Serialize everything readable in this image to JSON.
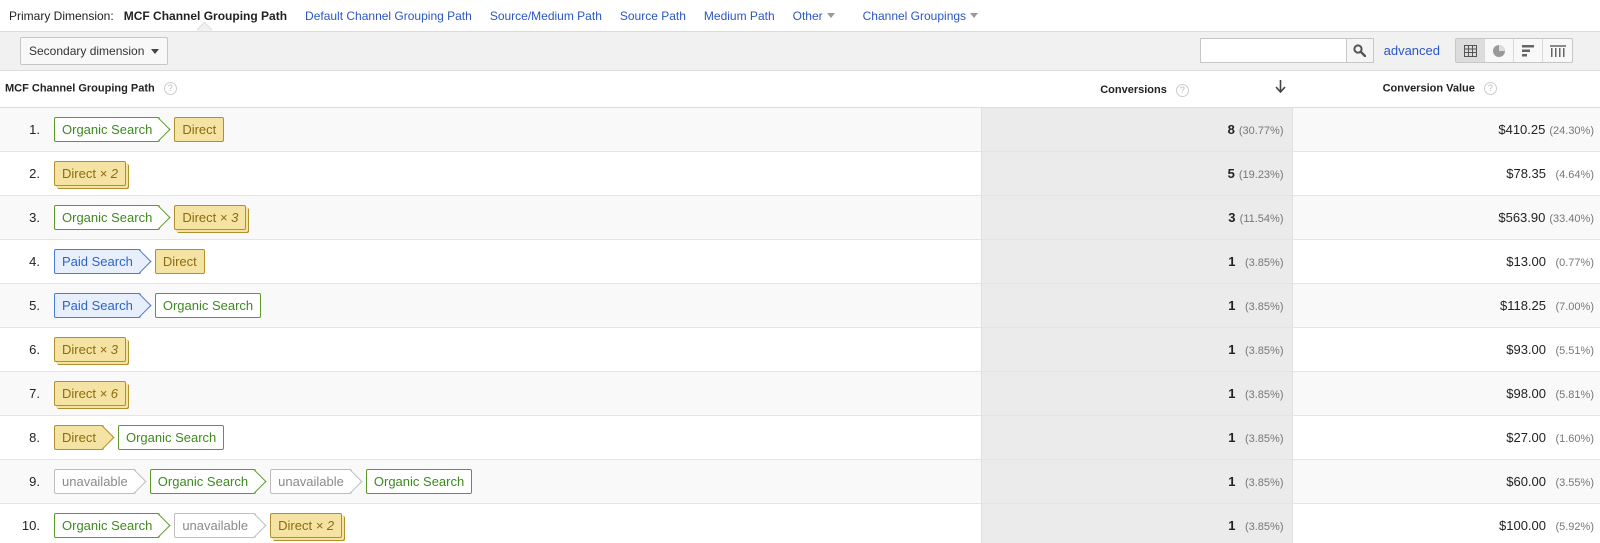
{
  "primary_dimension": {
    "label": "Primary Dimension:",
    "options": [
      {
        "label": "MCF Channel Grouping Path",
        "active": true
      },
      {
        "label": "Default Channel Grouping Path",
        "active": false
      },
      {
        "label": "Source/Medium Path",
        "active": false
      },
      {
        "label": "Source Path",
        "active": false
      },
      {
        "label": "Medium Path",
        "active": false
      }
    ],
    "other_label": "Other",
    "channel_groupings_label": "Channel Groupings"
  },
  "toolbar": {
    "secondary_dimension_label": "Secondary dimension",
    "search_value": "",
    "advanced_label": "advanced",
    "view_icons": [
      "table-view-icon",
      "pie-view-icon",
      "bar-view-icon",
      "comparison-view-icon"
    ]
  },
  "table": {
    "headers": {
      "path": "MCF Channel Grouping Path",
      "conversions": "Conversions",
      "value": "Conversion Value",
      "help": "?"
    },
    "rows": [
      {
        "index": "1.",
        "path": [
          {
            "type": "organic",
            "label": "Organic Search"
          },
          {
            "type": "direct",
            "label": "Direct"
          }
        ],
        "conversions": "8",
        "conv_pct": "(30.77%)",
        "value": "$410.25",
        "value_pct": "(24.30%)"
      },
      {
        "index": "2.",
        "path": [
          {
            "type": "direct",
            "label": "Direct",
            "mult": "× 2"
          }
        ],
        "conversions": "5",
        "conv_pct": "(19.23%)",
        "value": "$78.35",
        "value_pct": "(4.64%)"
      },
      {
        "index": "3.",
        "path": [
          {
            "type": "organic",
            "label": "Organic Search"
          },
          {
            "type": "direct",
            "label": "Direct",
            "mult": "× 3"
          }
        ],
        "conversions": "3",
        "conv_pct": "(11.54%)",
        "value": "$563.90",
        "value_pct": "(33.40%)"
      },
      {
        "index": "4.",
        "path": [
          {
            "type": "paid",
            "label": "Paid Search"
          },
          {
            "type": "direct",
            "label": "Direct"
          }
        ],
        "conversions": "1",
        "conv_pct": "(3.85%)",
        "value": "$13.00",
        "value_pct": "(0.77%)"
      },
      {
        "index": "5.",
        "path": [
          {
            "type": "paid",
            "label": "Paid Search"
          },
          {
            "type": "organic",
            "label": "Organic Search"
          }
        ],
        "conversions": "1",
        "conv_pct": "(3.85%)",
        "value": "$118.25",
        "value_pct": "(7.00%)"
      },
      {
        "index": "6.",
        "path": [
          {
            "type": "direct",
            "label": "Direct",
            "mult": "× 3"
          }
        ],
        "conversions": "1",
        "conv_pct": "(3.85%)",
        "value": "$93.00",
        "value_pct": "(5.51%)"
      },
      {
        "index": "7.",
        "path": [
          {
            "type": "direct",
            "label": "Direct",
            "mult": "× 6"
          }
        ],
        "conversions": "1",
        "conv_pct": "(3.85%)",
        "value": "$98.00",
        "value_pct": "(5.81%)"
      },
      {
        "index": "8.",
        "path": [
          {
            "type": "direct",
            "label": "Direct"
          },
          {
            "type": "organic",
            "label": "Organic Search"
          }
        ],
        "conversions": "1",
        "conv_pct": "(3.85%)",
        "value": "$27.00",
        "value_pct": "(1.60%)"
      },
      {
        "index": "9.",
        "path": [
          {
            "type": "unavail",
            "label": "unavailable"
          },
          {
            "type": "organic",
            "label": "Organic Search"
          },
          {
            "type": "unavail",
            "label": "unavailable"
          },
          {
            "type": "organic",
            "label": "Organic Search"
          }
        ],
        "conversions": "1",
        "conv_pct": "(3.85%)",
        "value": "$60.00",
        "value_pct": "(3.55%)"
      },
      {
        "index": "10.",
        "path": [
          {
            "type": "organic",
            "label": "Organic Search"
          },
          {
            "type": "unavail",
            "label": "unavailable"
          },
          {
            "type": "direct",
            "label": "Direct",
            "mult": "× 2"
          }
        ],
        "conversions": "1",
        "conv_pct": "(3.85%)",
        "value": "$100.00",
        "value_pct": "(5.92%)"
      }
    ]
  },
  "colors": {
    "link": "#2a56c6",
    "organic": "#3f8a1e",
    "paid": "#2f63c7",
    "direct_bg": "#f4e3a3",
    "unavailable": "#8a8a8a"
  }
}
